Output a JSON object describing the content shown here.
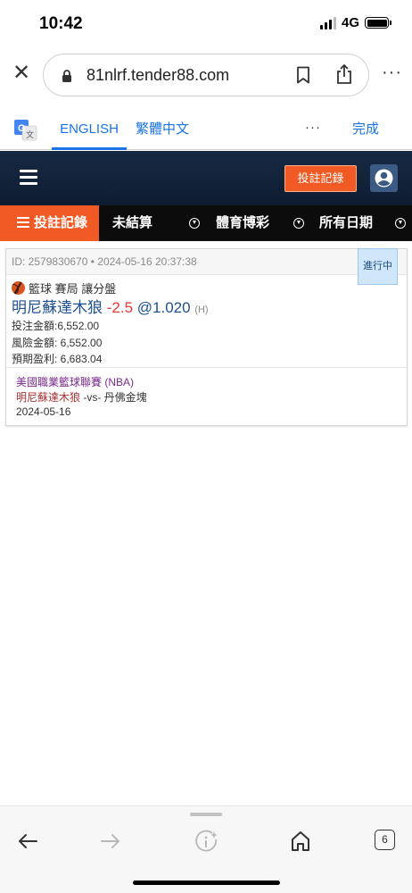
{
  "status_bar": {
    "time": "10:42",
    "network": "4G"
  },
  "browser": {
    "url": "81nlrf.tender88.com",
    "icons": [
      "close-icon",
      "lock-icon",
      "bookmark-icon",
      "share-icon",
      "more-icon"
    ]
  },
  "translate": {
    "tab_english": "ENGLISH",
    "tab_chinese": "繁體中文",
    "more": "···",
    "done": "完成"
  },
  "site_header": {
    "bet_records_button": "投註記錄"
  },
  "nav": {
    "active_tab": "投註記錄",
    "unsettled": "未結算",
    "sports": "體育博彩",
    "all_dates": "所有日期"
  },
  "bet": {
    "id_line": "ID: 2579830670 • 2024-05-16 20:37:38",
    "status": "進行中",
    "sport_line": "籃球 賽局 讓分盤",
    "team": "明尼蘇達木狼",
    "handicap": "-2.5",
    "odds": "@1.020",
    "side": "(H)",
    "stake": "投注金額:6,552.00",
    "risk": "風險金額: 6,552.00",
    "win": "預期盈利: 6,683.04",
    "league": "美國職業籃球聯賽 (NBA)",
    "home_team": "明尼蘇達木狼",
    "vs_away": "-vs- 丹佛金塊",
    "match_date": "2024-05-16"
  },
  "bottom_bar": {
    "tab_count": "6"
  },
  "colors": {
    "accent_orange": "#f15a24",
    "header_navy": "#172a44",
    "link_blue": "#1a73e8"
  }
}
